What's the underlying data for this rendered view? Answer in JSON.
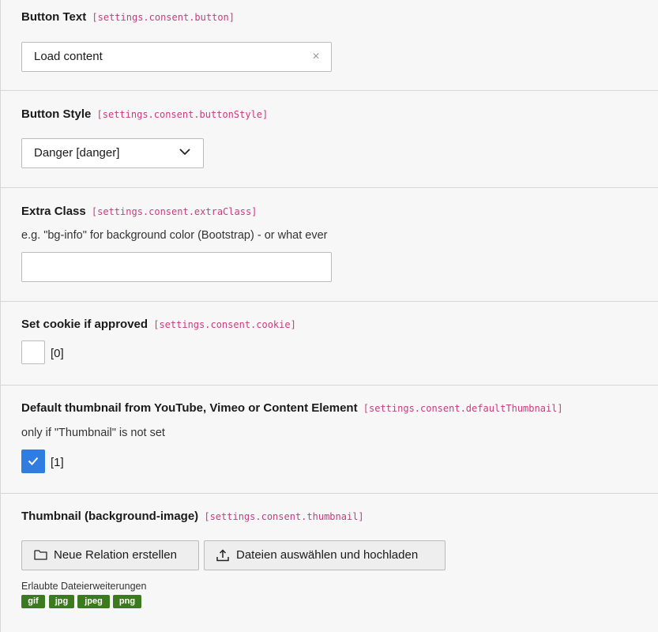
{
  "fields": {
    "button_text": {
      "label": "Button Text",
      "key": "[settings.consent.button]",
      "value": "Load content",
      "clear_glyph": "×"
    },
    "button_style": {
      "label": "Button Style",
      "key": "[settings.consent.buttonStyle]",
      "selected": "Danger [danger]"
    },
    "extra_class": {
      "label": "Extra Class",
      "key": "[settings.consent.extraClass]",
      "description": "e.g. \"bg-info\" for background color (Bootstrap) - or what ever",
      "value": ""
    },
    "cookie": {
      "label": "Set cookie if approved",
      "key": "[settings.consent.cookie]",
      "checked": false,
      "value_label": "[0]"
    },
    "default_thumbnail": {
      "label": "Default thumbnail from YouTube, Vimeo or Content Element",
      "key": "[settings.consent.defaultThumbnail]",
      "description": "only if \"Thumbnail\" is not set",
      "checked": true,
      "value_label": "[1]"
    },
    "thumbnail": {
      "label": "Thumbnail (background-image)",
      "key": "[settings.consent.thumbnail]",
      "new_relation_label": "Neue Relation erstellen",
      "upload_label": "Dateien auswählen und hochladen",
      "allowed_label": "Erlaubte Dateierweiterungen",
      "extensions": [
        "gif",
        "jpg",
        "jpeg",
        "png"
      ]
    }
  },
  "colors": {
    "key_pink": "#c83c7e",
    "checkbox_blue": "#2f7de1",
    "badge_green": "#3b7b1d",
    "background": "#f7f7f7"
  },
  "icons": {
    "dropdown": "chevron-down-icon",
    "checkmark": "checkmark-icon",
    "new_relation": "folder-icon",
    "upload": "upload-icon",
    "clear": "close-icon"
  }
}
